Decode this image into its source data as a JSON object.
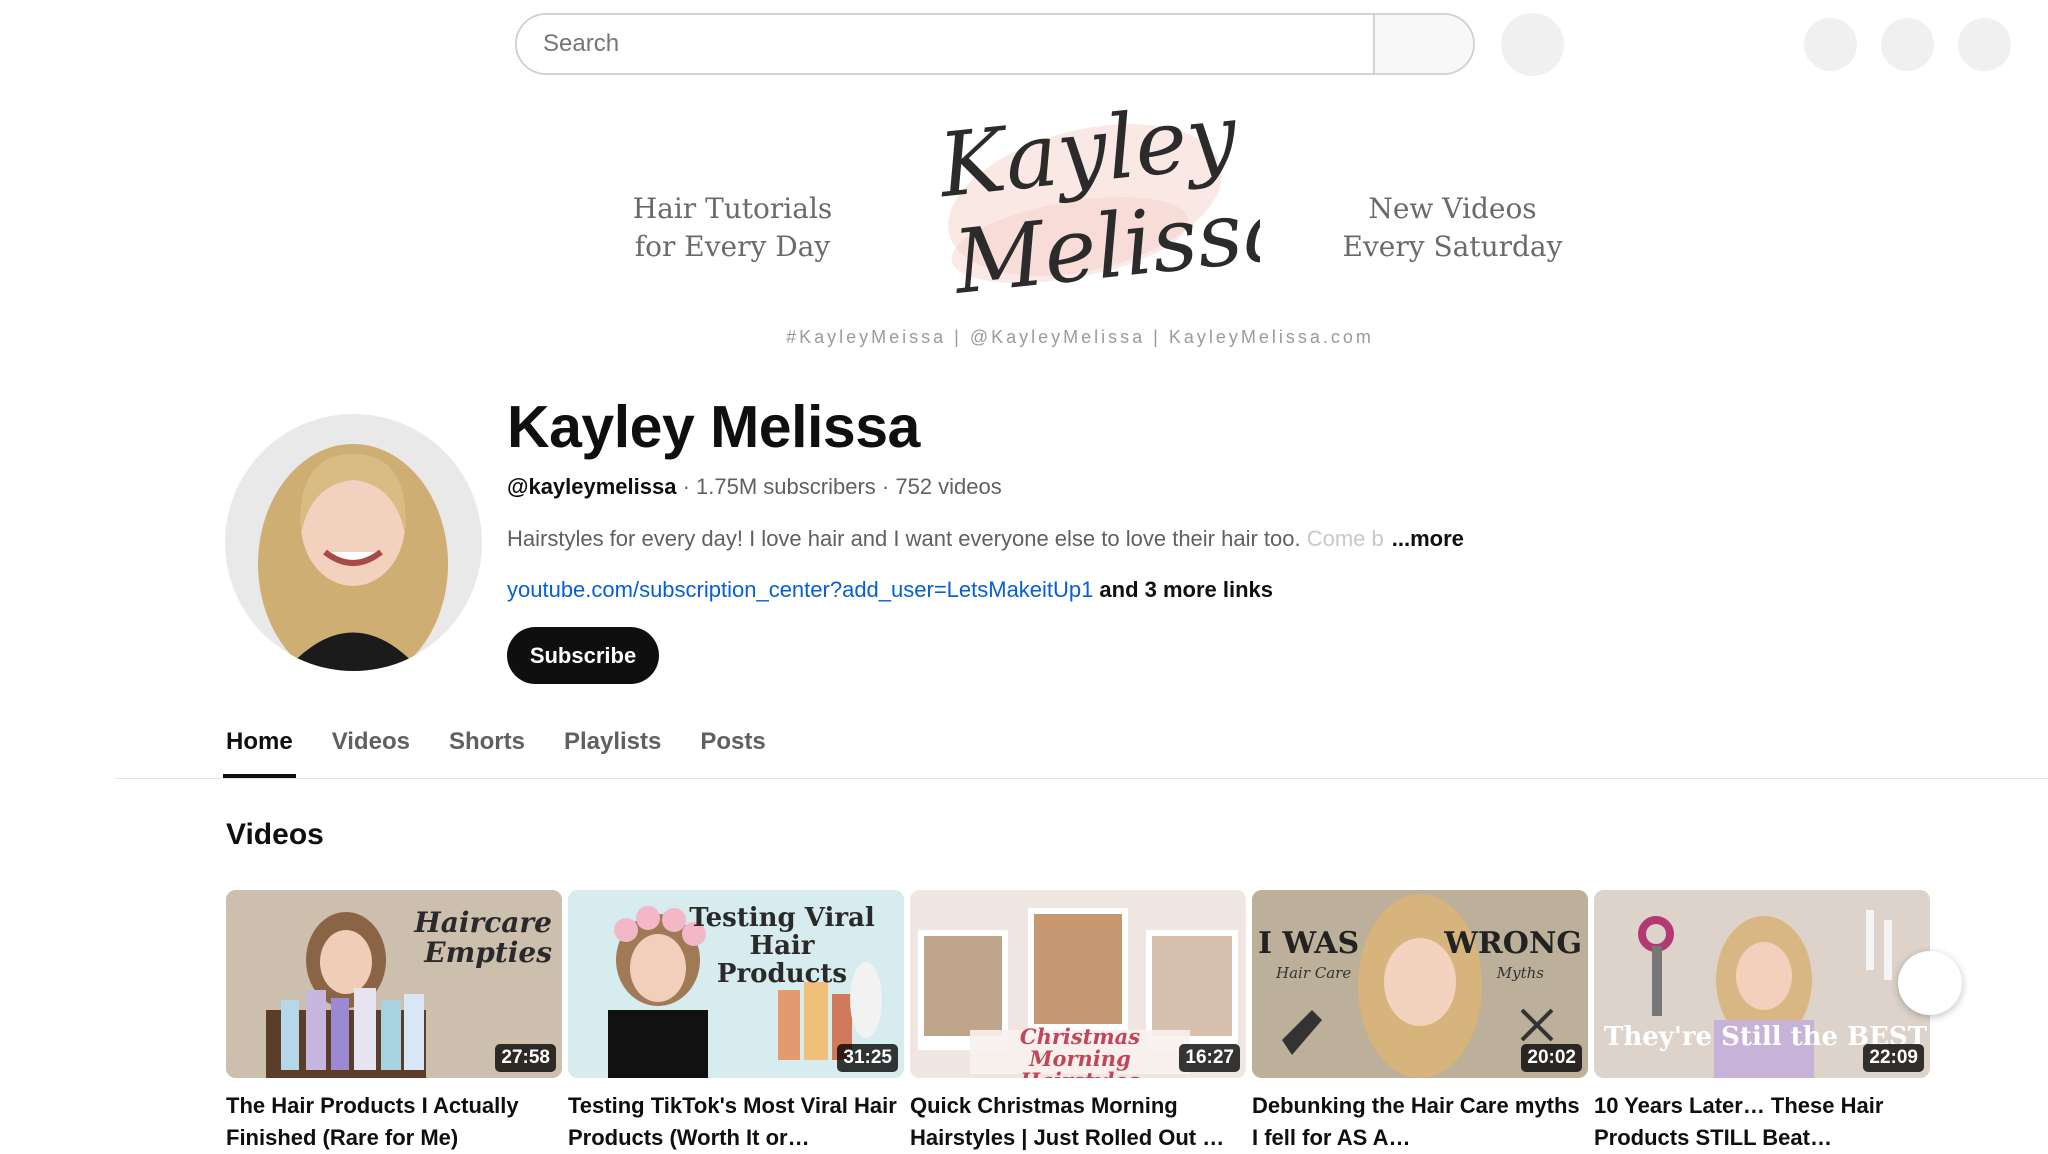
{
  "header": {
    "search_placeholder": "Search"
  },
  "banner": {
    "logo_text": "Kayley Melissa",
    "left_tagline_1": "Hair Tutorials",
    "left_tagline_2": "for Every Day",
    "right_tagline_1": "New Videos",
    "right_tagline_2": "Every Saturday",
    "handles": "#KayleyMeissa | @KayleyMelissa | KayleyMelissa.com"
  },
  "channel": {
    "name": "Kayley Melissa",
    "handle": "@kayleymelissa",
    "subscribers": "1.75M subscribers",
    "videos_count": "752 videos",
    "meta_separator": " · ",
    "description": "Hairstyles for every day! I love hair and I want everyone else to love their hair too.",
    "description_faded": " Come b",
    "more_label": "...more",
    "link_url": "youtube.com/subscription_center?add_user=LetsMakeitUp1",
    "more_links": "and 3 more links",
    "subscribe_label": "Subscribe"
  },
  "tabs": [
    {
      "label": "Home",
      "active": true
    },
    {
      "label": "Videos",
      "active": false
    },
    {
      "label": "Shorts",
      "active": false
    },
    {
      "label": "Playlists",
      "active": false
    },
    {
      "label": "Posts",
      "active": false
    }
  ],
  "section": {
    "title": "Videos"
  },
  "videos": [
    {
      "title": "The Hair Products I Actually Finished (Rare for Me)",
      "duration": "27:58",
      "thumb_text": "Haircare Empties",
      "bg": "#b8aa98"
    },
    {
      "title": "Testing TikTok's Most Viral Hair Products (Worth It or…",
      "duration": "31:25",
      "thumb_text": "Testing Viral Hair Products",
      "bg": "#cfe6ea"
    },
    {
      "title": "Quick Christmas Morning Hairstyles | Just Rolled Out …",
      "duration": "16:27",
      "thumb_text": "Christmas Morning Hairstyles",
      "bg": "#f1e7e3"
    },
    {
      "title": "Debunking the Hair Care myths I fell for AS A…",
      "duration": "20:02",
      "thumb_text_left": "I WAS",
      "thumb_text_right": "WRONG",
      "thumb_sub_left": "Hair Care",
      "thumb_sub_right": "Myths",
      "bg": "#b7a890"
    },
    {
      "title": "10 Years Later… These Hair Products STILL Beat…",
      "duration": "22:09",
      "thumb_text": "They're Still the BEST!",
      "bg": "#d9cfc6"
    }
  ]
}
